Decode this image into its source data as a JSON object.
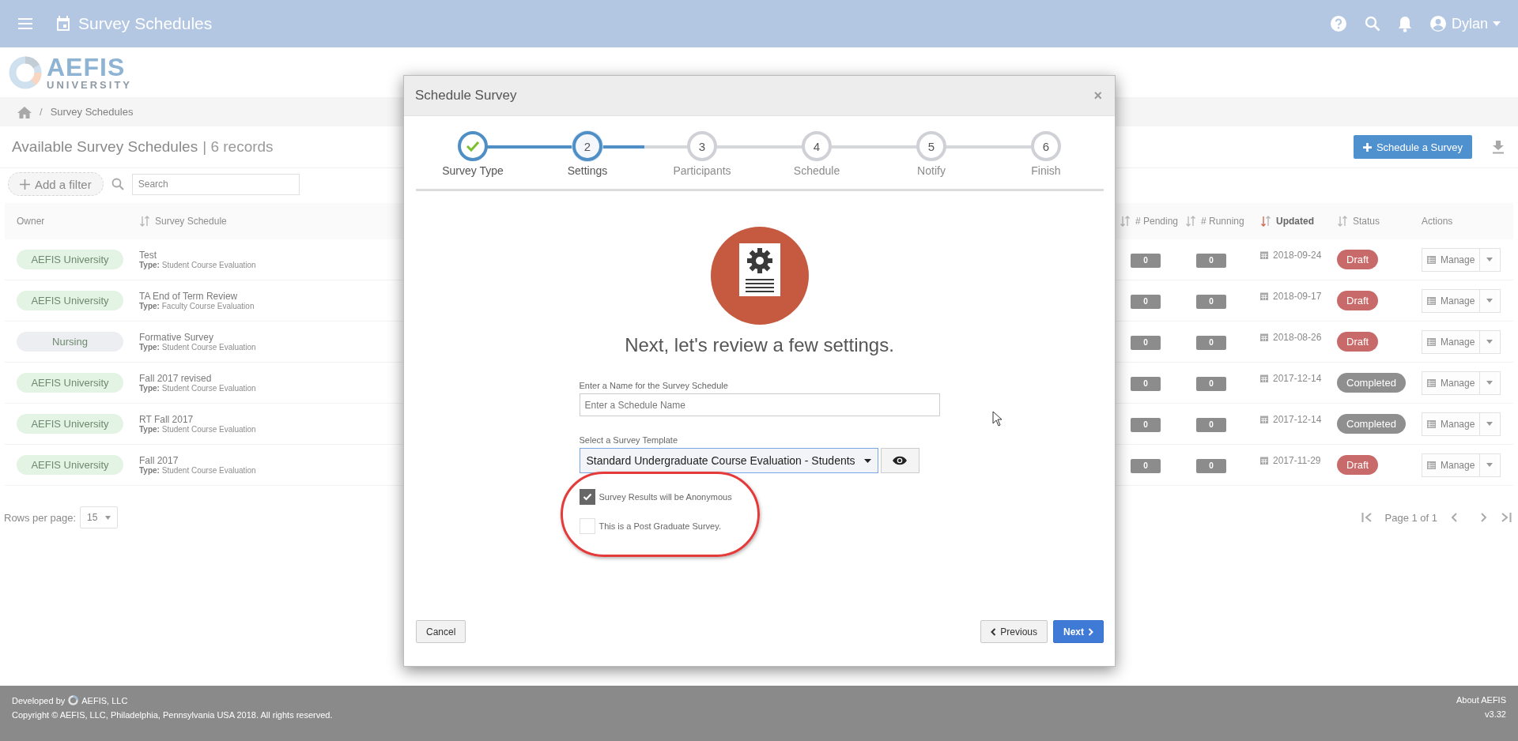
{
  "header": {
    "title": "Survey Schedules",
    "user": "Dylan"
  },
  "logo": {
    "name": "AEFIS",
    "subtitle": "UNIVERSITY"
  },
  "breadcrumb": {
    "separator": "/",
    "current": "Survey Schedules"
  },
  "list": {
    "title": "Available Survey Schedules",
    "separator": "|",
    "count": "6 records",
    "add_button": "Schedule a Survey",
    "filter_button": "Add a filter",
    "search_placeholder": "Search"
  },
  "table": {
    "columns": [
      {
        "label": "Owner",
        "sortable": false,
        "sorted": false
      },
      {
        "label": "Survey Schedule",
        "sortable": true,
        "sorted": false
      },
      {
        "label": "# Pending",
        "sortable": true,
        "sorted": false
      },
      {
        "label": "# Running",
        "sortable": true,
        "sorted": false
      },
      {
        "label": "Updated",
        "sortable": true,
        "sorted": true
      },
      {
        "label": "Status",
        "sortable": true,
        "sorted": false
      },
      {
        "label": "Actions",
        "sortable": false,
        "sorted": false
      }
    ],
    "rows": [
      {
        "owner": {
          "label": "AEFIS University",
          "color": "#e3f3e4"
        },
        "name": "Test",
        "type": "**Type:** Student Course Evaluation",
        "pending": "0",
        "running": "0",
        "updated": "2018-09-24",
        "status": {
          "label": "Draft",
          "color": "#c96a6a"
        },
        "action": "Manage"
      },
      {
        "owner": {
          "label": "AEFIS University",
          "color": "#e3f3e4"
        },
        "name": "TA End of Term Review",
        "type": "**Type:** Faculty Course Evaluation",
        "pending": "0",
        "running": "0",
        "updated": "2018-09-17",
        "status": {
          "label": "Draft",
          "color": "#c96a6a"
        },
        "action": "Manage"
      },
      {
        "owner": {
          "label": "Nursing",
          "color": "#eceef1"
        },
        "name": "Formative Survey",
        "type": "**Type:** Student Course Evaluation",
        "pending": "0",
        "running": "0",
        "updated": "2018-08-26",
        "status": {
          "label": "Draft",
          "color": "#c96a6a"
        },
        "action": "Manage"
      },
      {
        "owner": {
          "label": "AEFIS University",
          "color": "#e3f3e4"
        },
        "name": "Fall 2017 revised",
        "type": "**Type:** Student Course Evaluation",
        "pending": "0",
        "running": "0",
        "updated": "2017-12-14",
        "status": {
          "label": "Completed",
          "color": "#8f8f8f"
        },
        "action": "Manage"
      },
      {
        "owner": {
          "label": "AEFIS University",
          "color": "#e3f3e4"
        },
        "name": "RT Fall 2017",
        "type": "**Type:** Student Course Evaluation",
        "pending": "0",
        "running": "0",
        "updated": "2017-12-14",
        "status": {
          "label": "Completed",
          "color": "#8f8f8f"
        },
        "action": "Manage"
      },
      {
        "owner": {
          "label": "AEFIS University",
          "color": "#e3f3e4"
        },
        "name": "Fall 2017",
        "type": "**Type:** Student Course Evaluation",
        "pending": "0",
        "running": "0",
        "updated": "2017-11-29",
        "status": {
          "label": "Draft",
          "color": "#c96a6a"
        },
        "action": "Manage"
      }
    ]
  },
  "pagination": {
    "rows_per_page_label": "Rows per page:",
    "rows_per_page": "15",
    "page_label": "Page 1 of 1"
  },
  "modal": {
    "title": "Schedule Survey",
    "close": "×",
    "steps": [
      {
        "label": "Survey Type",
        "completed": true,
        "selected": false
      },
      {
        "number": "2",
        "label": "Settings",
        "completed": false,
        "selected": true
      },
      {
        "number": "3",
        "label": "Participants",
        "completed": false,
        "selected": false
      },
      {
        "number": "4",
        "label": "Schedule",
        "completed": false,
        "selected": false
      },
      {
        "number": "5",
        "label": "Notify",
        "completed": false,
        "selected": false
      },
      {
        "number": "6",
        "label": "Finish",
        "completed": false,
        "selected": false
      }
    ],
    "heading": "Next, let's review a few settings.",
    "name_field": {
      "label": "Enter a Name for the Survey Schedule",
      "placeholder": "Enter a Schedule Name"
    },
    "template_field": {
      "label": "Select a Survey Template",
      "value": "Standard Undergraduate Course Evaluation - Students"
    },
    "checkboxes": [
      {
        "label": "Survey Results will be Anonymous",
        "checked": true
      },
      {
        "label": "This is a Post Graduate Survey.",
        "checked": false
      }
    ],
    "cancel": "Cancel",
    "previous": "Previous",
    "next": "Next"
  },
  "footer": {
    "developed_by": "Developed by",
    "company": "AEFIS, LLC",
    "copyright": "Copyright © AEFIS, LLC, Philadelphia, Pennsylvania USA 2018. All rights reserved.",
    "about": "About AEFIS",
    "version": "v3.32"
  }
}
